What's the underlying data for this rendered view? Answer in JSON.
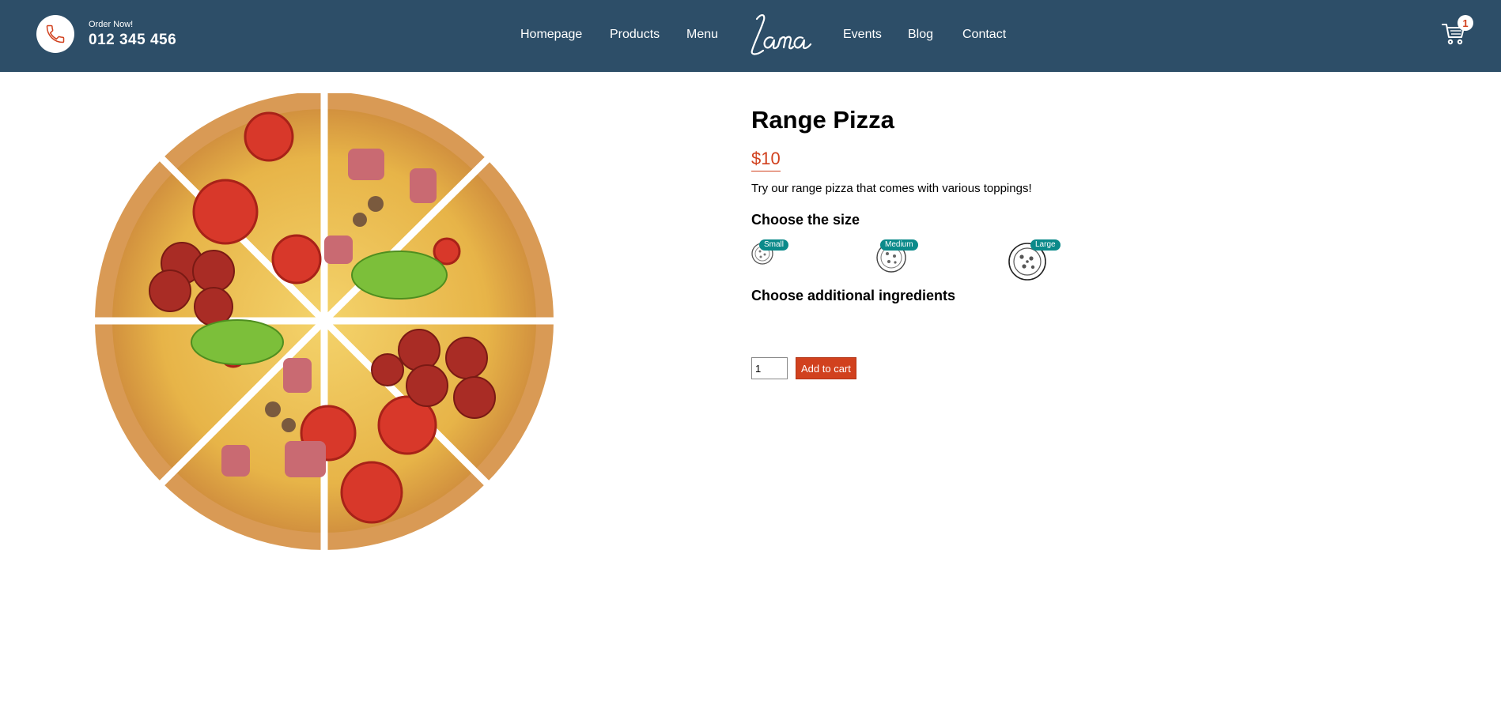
{
  "navbar": {
    "order_label": "Order Now!",
    "phone": "012 345 456",
    "links": [
      "Homepage",
      "Products",
      "Menu",
      "Events",
      "Blog",
      "Contact"
    ],
    "logo_text": "Lama",
    "cart_count": "1",
    "icons": {
      "phone": "phone-icon",
      "cart": "cart-icon"
    }
  },
  "product": {
    "title": "Range Pizza",
    "price": "$10",
    "description": "Try our range pizza that comes with various toppings!",
    "size_heading": "Choose the size",
    "sizes": [
      "Small",
      "Medium",
      "Large"
    ],
    "ingredients_heading": "Choose additional ingredients",
    "quantity": "1",
    "add_to_cart_label": "Add to cart"
  },
  "colors": {
    "navbar_bg": "#2d4e68",
    "accent": "#d1411e",
    "badge": "#0b8a8a"
  }
}
